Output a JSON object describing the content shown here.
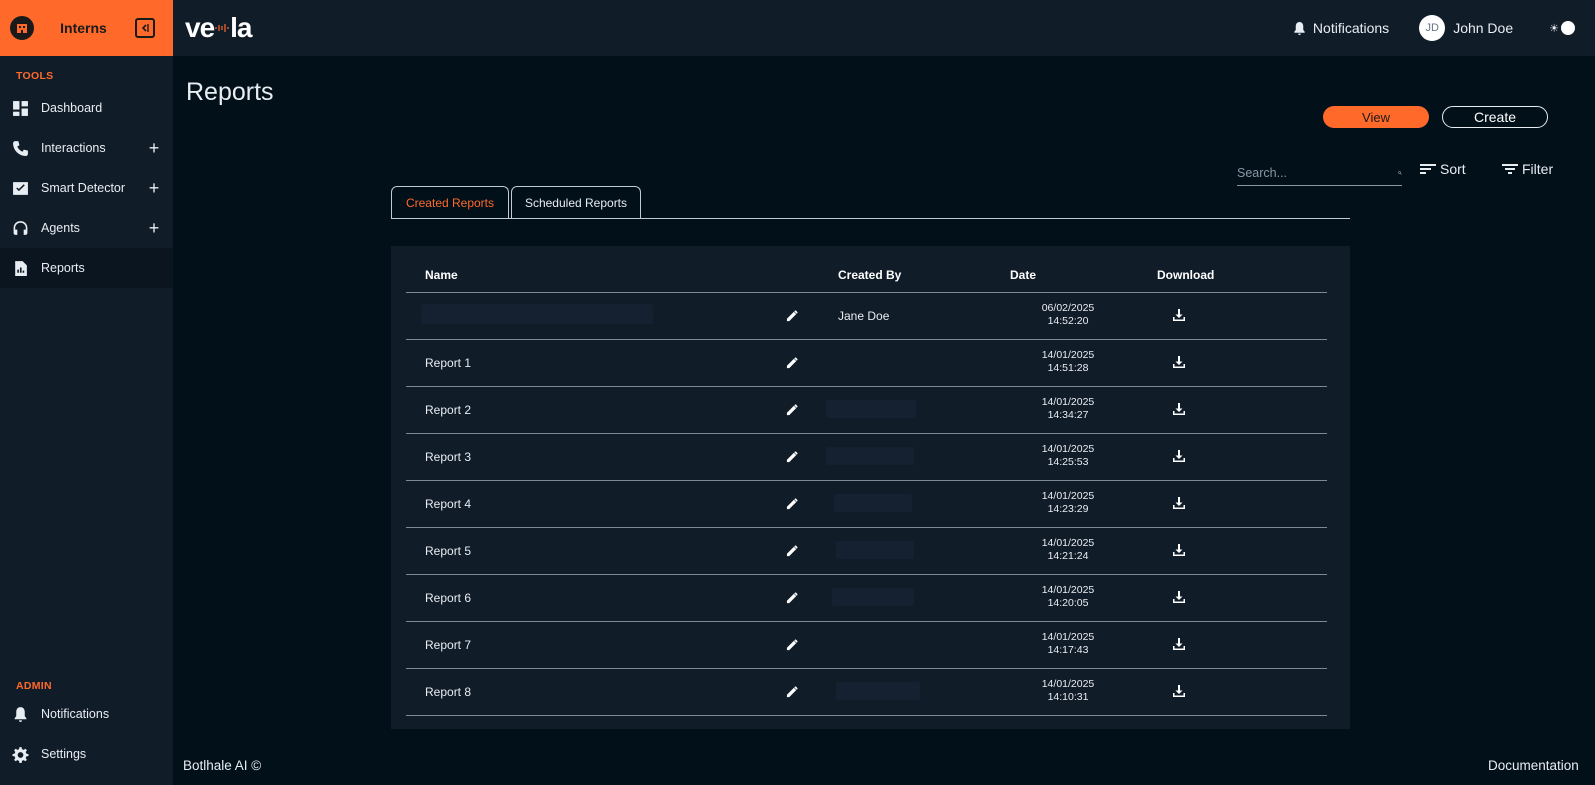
{
  "org": {
    "name": "Interns"
  },
  "brand": {
    "name_left": "ve",
    "name_right": "la"
  },
  "sidebar": {
    "tools_label": "TOOLS",
    "items": [
      {
        "label": "Dashboard",
        "icon": "dashboard-icon",
        "expandable": false
      },
      {
        "label": "Interactions",
        "icon": "phone-icon",
        "expandable": true
      },
      {
        "label": "Smart Detector",
        "icon": "check-chart-icon",
        "expandable": true
      },
      {
        "label": "Agents",
        "icon": "headset-icon",
        "expandable": true
      },
      {
        "label": "Reports",
        "icon": "report-icon",
        "expandable": false,
        "active": true
      }
    ],
    "admin_label": "ADMIN",
    "admin_items": [
      {
        "label": "Notifications",
        "icon": "bell-icon"
      },
      {
        "label": "Settings",
        "icon": "gear-icon"
      }
    ]
  },
  "topbar": {
    "notifications_label": "Notifications",
    "user_initials": "JD",
    "user_name": "John Doe"
  },
  "page": {
    "title": "Reports",
    "view_label": "View",
    "create_label": "Create",
    "search_placeholder": "Search...",
    "sort_label": "Sort",
    "filter_label": "Filter"
  },
  "tabs": [
    {
      "label": "Created Reports",
      "active": true
    },
    {
      "label": "Scheduled Reports",
      "active": false
    }
  ],
  "table": {
    "columns": [
      "Name",
      "Created By",
      "Date",
      "Download"
    ],
    "rows": [
      {
        "name": "",
        "created_by": "Jane Doe",
        "date": "06/02/2025",
        "time": "14:52:20"
      },
      {
        "name": "Report 1",
        "created_by": "",
        "date": "14/01/2025",
        "time": "14:51:28"
      },
      {
        "name": "Report 2",
        "created_by": "",
        "date": "14/01/2025",
        "time": "14:34:27"
      },
      {
        "name": "Report 3",
        "created_by": "",
        "date": "14/01/2025",
        "time": "14:25:53"
      },
      {
        "name": "Report 4",
        "created_by": "",
        "date": "14/01/2025",
        "time": "14:23:29"
      },
      {
        "name": "Report 5",
        "created_by": "",
        "date": "14/01/2025",
        "time": "14:21:24"
      },
      {
        "name": "Report 6",
        "created_by": "",
        "date": "14/01/2025",
        "time": "14:20:05"
      },
      {
        "name": "Report 7",
        "created_by": "",
        "date": "14/01/2025",
        "time": "14:17:43"
      },
      {
        "name": "Report 8",
        "created_by": "",
        "date": "14/01/2025",
        "time": "14:10:31"
      }
    ]
  },
  "footer": {
    "left": "Botlhale AI ©",
    "right": "Documentation"
  },
  "colors": {
    "accent": "#ff6a2b",
    "sidebar_bg": "#111c29",
    "page_bg": "#02101a"
  }
}
